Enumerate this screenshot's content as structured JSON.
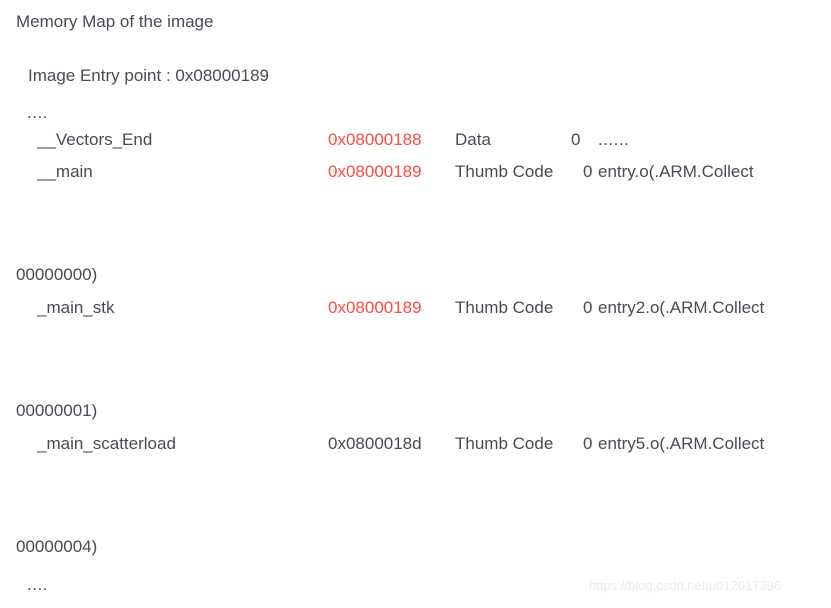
{
  "document": {
    "title": "Memory Map of the image",
    "entry_point_line": "Image Entry point : 0x08000189",
    "ellipsis_top": "....",
    "ellipsis_bottom": "...."
  },
  "colors": {
    "text": "#4a4a55",
    "highlight_red": "#fc4a46",
    "background": "#ffffff",
    "watermark": "#ececec"
  },
  "symbols": [
    {
      "name": "__Vectors_End",
      "address": "0x08000188",
      "address_color": "red",
      "type": "Data",
      "size": "0",
      "object": "......"
    },
    {
      "name": "__main",
      "address": "0x08000189",
      "address_color": "red",
      "type": "Thumb Code",
      "size": "0",
      "object": "entry.o(.ARM.Collect"
    },
    {
      "name": "_main_stk",
      "address": "0x08000189",
      "address_color": "red",
      "type": "Thumb Code",
      "size": "0",
      "object": "entry2.o(.ARM.Collect"
    },
    {
      "name": "_main_scatterload",
      "address": "0x0800018d",
      "address_color": "gray",
      "type": "Thumb Code",
      "size": "0",
      "object": "entry5.o(.ARM.Collect"
    }
  ],
  "wrapped_offsets": [
    {
      "value": "00000000)"
    },
    {
      "value": "00000001)"
    },
    {
      "value": "00000004)"
    }
  ],
  "watermark": {
    "text": "https://blog.csdn.net/u012017396"
  }
}
